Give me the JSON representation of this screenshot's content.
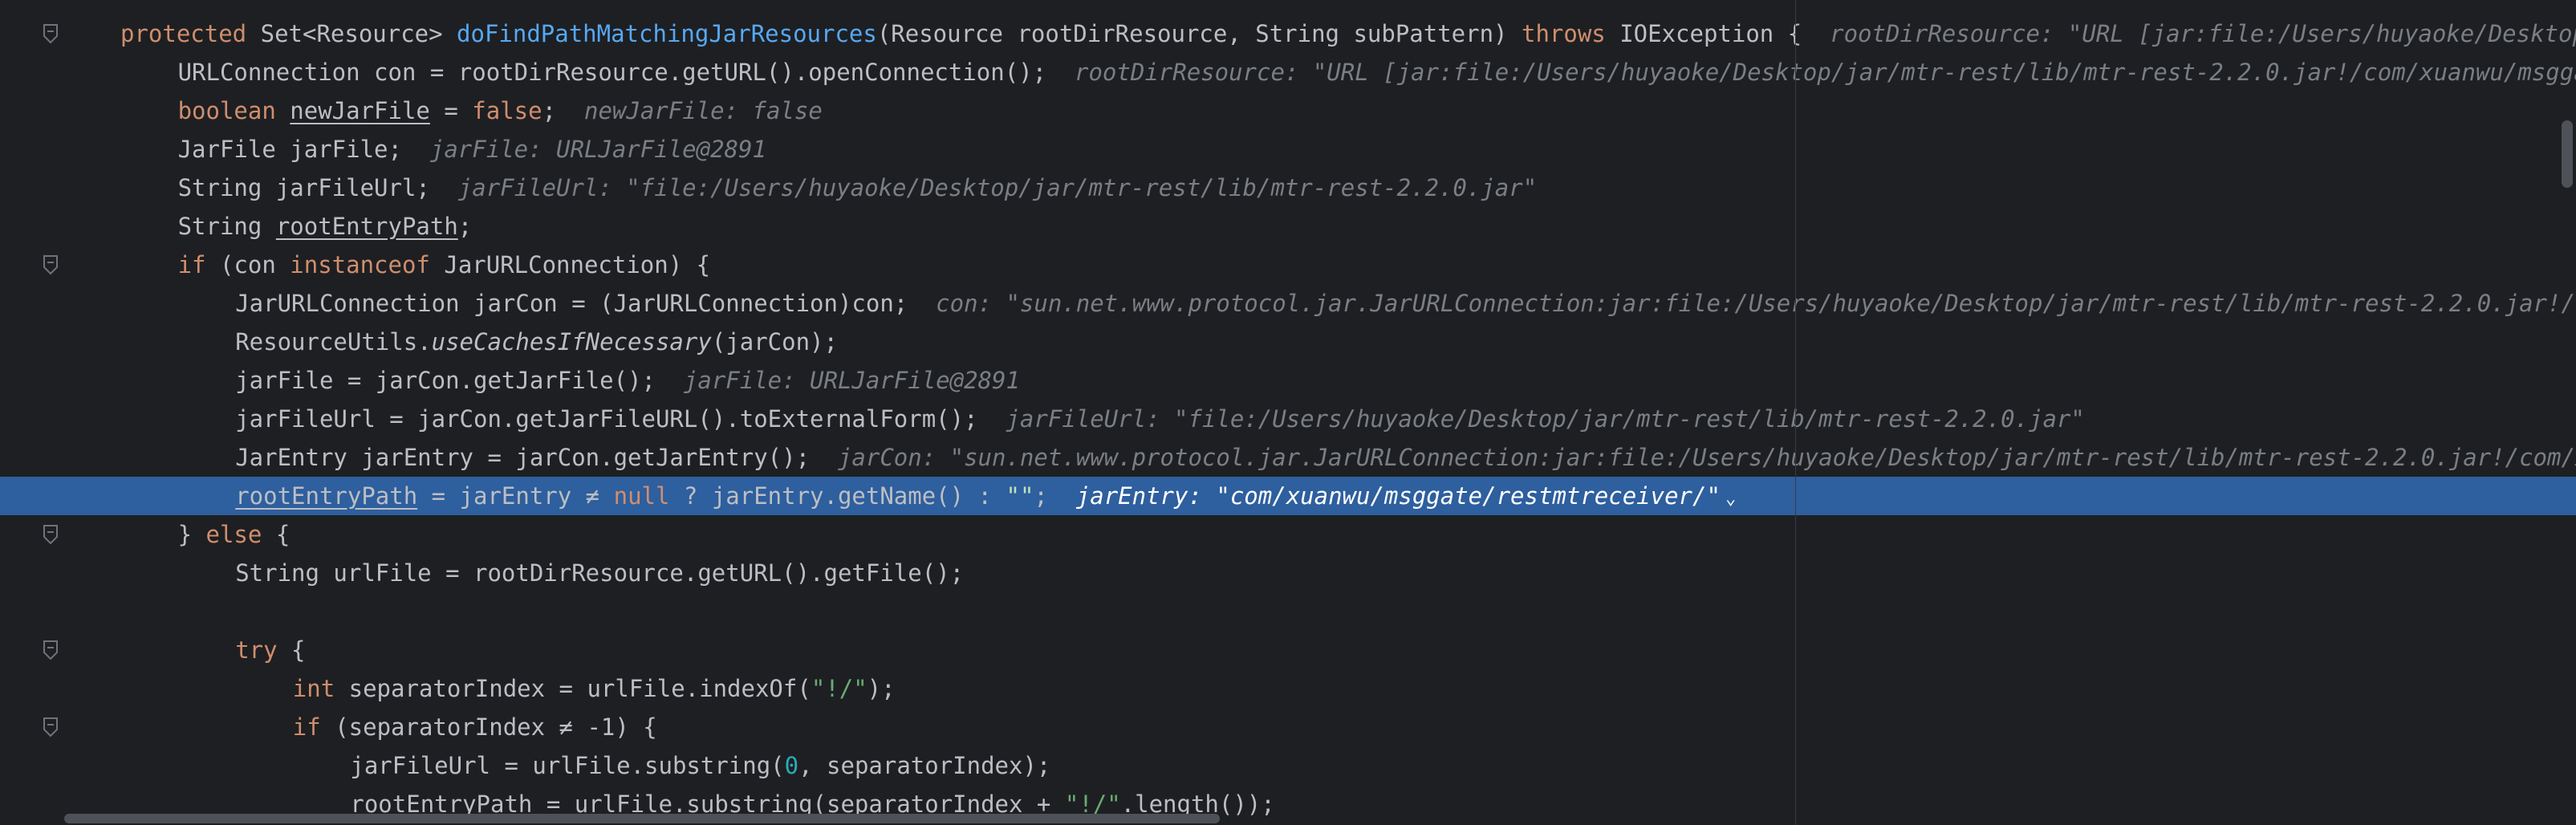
{
  "editor": {
    "lines": [
      {
        "segments": [
          {
            "t": "protected ",
            "c": "kw"
          },
          {
            "t": "Set<Resource> "
          },
          {
            "t": "doFindPathMatchingJarResources",
            "c": "fn-decl"
          },
          {
            "t": "(Resource rootDirResource, String subPattern) "
          },
          {
            "t": "throws ",
            "c": "kw"
          },
          {
            "t": "IOException {"
          }
        ],
        "hint": "rootDirResource: \"URL [jar:file:/Users/huyaoke/Desktop/jar/mtr-rest/lib/mtr-rest-2.2.0.jar!/com/xuanwu/msggate/restmtreceiver/]\""
      },
      {
        "segments": [
          {
            "t": "    URLConnection con = rootDirResource.getURL().openConnection();"
          }
        ],
        "hint": "rootDirResource: \"URL [jar:file:/Users/huyaoke/Desktop/jar/mtr-rest/lib/mtr-rest-2.2.0.jar!/com/xuanwu/msggate/restmtreceiver/]\""
      },
      {
        "segments": [
          {
            "t": "    "
          },
          {
            "t": "boolean ",
            "c": "kw"
          },
          {
            "t": "newJarFile",
            "c": "ul"
          },
          {
            "t": " = "
          },
          {
            "t": "false",
            "c": "kw"
          },
          {
            "t": ";"
          }
        ],
        "hint": "newJarFile: false"
      },
      {
        "segments": [
          {
            "t": "    JarFile jarFile;"
          }
        ],
        "hint": "jarFile: URLJarFile@2891"
      },
      {
        "segments": [
          {
            "t": "    String jarFileUrl;"
          }
        ],
        "hint": "jarFileUrl: \"file:/Users/huyaoke/Desktop/jar/mtr-rest/lib/mtr-rest-2.2.0.jar\""
      },
      {
        "segments": [
          {
            "t": "    String "
          },
          {
            "t": "rootEntryPath",
            "c": "ul"
          },
          {
            "t": ";"
          }
        ],
        "hint": ""
      },
      {
        "segments": [
          {
            "t": "    "
          },
          {
            "t": "if ",
            "c": "kw"
          },
          {
            "t": "(con "
          },
          {
            "t": "instanceof ",
            "c": "kw"
          },
          {
            "t": "JarURLConnection) {"
          }
        ],
        "hint": ""
      },
      {
        "segments": [
          {
            "t": "        JarURLConnection jarCon = (JarURLConnection)con;"
          }
        ],
        "hint": "con: \"sun.net.www.protocol.jar.JarURLConnection:jar:file:/Users/huyaoke/Desktop/jar/mtr-rest/lib/mtr-rest-2.2.0.jar!/com/xuanwu/msggate/restmtreceiver/\""
      },
      {
        "segments": [
          {
            "t": "        ResourceUtils."
          },
          {
            "t": "useCachesIfNecessary",
            "c": "it"
          },
          {
            "t": "(jarCon);"
          }
        ],
        "hint": ""
      },
      {
        "segments": [
          {
            "t": "        jarFile = jarCon.getJarFile();"
          }
        ],
        "hint": "jarFile: URLJarFile@2891"
      },
      {
        "segments": [
          {
            "t": "        jarFileUrl = jarCon.getJarFileURL().toExternalForm();"
          }
        ],
        "hint": "jarFileUrl: \"file:/Users/huyaoke/Desktop/jar/mtr-rest/lib/mtr-rest-2.2.0.jar\""
      },
      {
        "segments": [
          {
            "t": "        JarEntry jarEntry = jarCon.getJarEntry();"
          }
        ],
        "hint": "jarCon: \"sun.net.www.protocol.jar.JarURLConnection:jar:file:/Users/huyaoke/Desktop/jar/mtr-rest/lib/mtr-rest-2.2.0.jar!/com/xuanwu/msggate/restmtreceiver/\""
      },
      {
        "segments": [
          {
            "t": "        "
          },
          {
            "t": "rootEntryPath",
            "c": "ul"
          },
          {
            "t": " = jarEntry ≠ "
          },
          {
            "t": "null",
            "c": "kw"
          },
          {
            "t": " ? jarEntry.getName() : "
          },
          {
            "t": "\"\"",
            "c": "str"
          },
          {
            "t": ";"
          }
        ],
        "hint": "jarEntry: \"com/xuanwu/msggate/restmtreceiver/\"",
        "current": true
      },
      {
        "segments": [
          {
            "t": "    } "
          },
          {
            "t": "else",
            "c": "kw"
          },
          {
            "t": " {"
          }
        ],
        "hint": ""
      },
      {
        "segments": [
          {
            "t": "        String urlFile = rootDirResource.getURL().getFile();"
          }
        ],
        "hint": ""
      },
      {
        "segments": [],
        "hint": ""
      },
      {
        "segments": [
          {
            "t": "        "
          },
          {
            "t": "try",
            "c": "kw"
          },
          {
            "t": " {"
          }
        ],
        "hint": ""
      },
      {
        "segments": [
          {
            "t": "            "
          },
          {
            "t": "int ",
            "c": "kw"
          },
          {
            "t": "separatorIndex = urlFile.indexOf("
          },
          {
            "t": "\"!/\"",
            "c": "str"
          },
          {
            "t": ");"
          }
        ],
        "hint": ""
      },
      {
        "segments": [
          {
            "t": "            "
          },
          {
            "t": "if ",
            "c": "kw"
          },
          {
            "t": "(separatorIndex ≠ -1) {"
          }
        ],
        "hint": ""
      },
      {
        "segments": [
          {
            "t": "                jarFileUrl = urlFile.substring("
          },
          {
            "t": "0",
            "c": "num"
          },
          {
            "t": ", separatorIndex);"
          }
        ],
        "hint": ""
      },
      {
        "segments": [
          {
            "t": "                rootEntryPath = urlFile.substring(separatorIndex + "
          },
          {
            "t": "\"!/\"",
            "c": "str"
          },
          {
            "t": ".length());"
          }
        ],
        "hint": ""
      }
    ],
    "fold_markers": [
      0,
      6,
      13,
      16,
      18
    ]
  }
}
